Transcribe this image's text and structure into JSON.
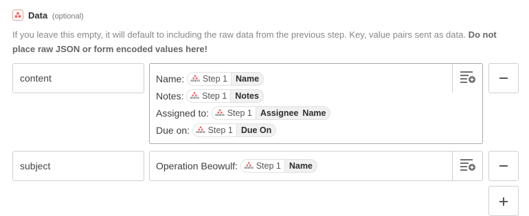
{
  "field": {
    "title": "Data",
    "optional_label": "(optional)",
    "icon": "asana-icon",
    "help_text": "If you leave this empty, it will default to including the raw data from the previous step. Key, value pairs sent as data.",
    "help_text_bold": "Do not place raw JSON or form encoded values here!"
  },
  "rows": [
    {
      "key": "content",
      "lines": [
        {
          "label": "Name:",
          "pill_source": "Step 1",
          "pill_fields": [
            "Name"
          ]
        },
        {
          "label": "Notes:",
          "pill_source": "Step 1",
          "pill_fields": [
            "Notes"
          ]
        },
        {
          "label": "Assigned to:",
          "pill_source": "Step 1",
          "pill_fields": [
            "Assignee",
            "Name"
          ]
        },
        {
          "label": "Due on:",
          "pill_source": "Step 1",
          "pill_fields": [
            "Due On"
          ]
        }
      ]
    },
    {
      "key": "subject",
      "lines": [
        {
          "label": "Operation Beowulf:",
          "pill_source": "Step 1",
          "pill_fields": [
            "Name"
          ]
        }
      ]
    }
  ],
  "pill_logo_word": "asana",
  "colors": {
    "asana_brand": "#f06a6a",
    "border": "#cfcfcf",
    "pill_bg": "#f1f1f1"
  },
  "icons": {
    "insert_field": "insert-field-icon",
    "remove_row": "minus-icon",
    "add_row": "plus-icon"
  }
}
